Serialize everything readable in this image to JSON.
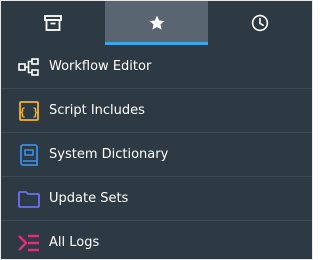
{
  "tabs": [
    {
      "name": "archive",
      "icon": "archive-icon"
    },
    {
      "name": "favorites",
      "icon": "star-icon",
      "active": true
    },
    {
      "name": "history",
      "icon": "clock-icon"
    }
  ],
  "colors": {
    "background": "#2e3a43",
    "active_tab": "#596570",
    "accent": "#3aa5e8"
  },
  "favorites": [
    {
      "label": "Workflow Editor",
      "icon": "workflow-icon",
      "color": "#ffffff"
    },
    {
      "label": "Script Includes",
      "icon": "script-braces-icon",
      "color": "#f2b233"
    },
    {
      "label": "System Dictionary",
      "icon": "dictionary-icon",
      "color": "#3a8fe8"
    },
    {
      "label": "Update Sets",
      "icon": "folder-icon",
      "color": "#6f6ff0"
    },
    {
      "label": "All Logs",
      "icon": "logs-icon",
      "color": "#e0307a"
    }
  ]
}
